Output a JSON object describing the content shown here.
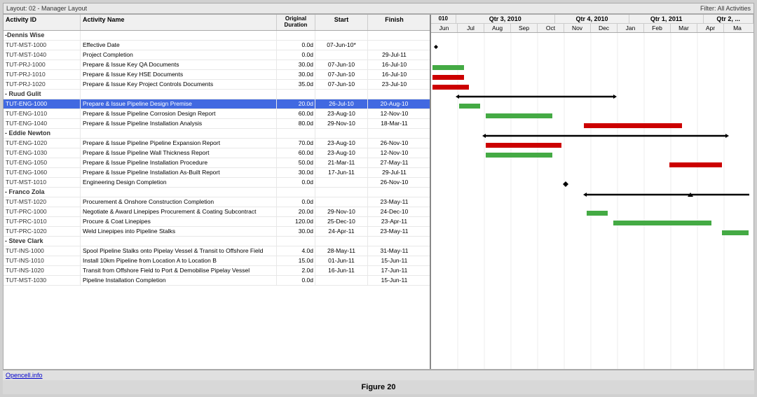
{
  "topbar": {
    "left": "Layout: 02 - Manager Layout",
    "right": "Filter: All Activities"
  },
  "columns": {
    "id": "Activity ID",
    "name": "Activity Name",
    "duration": "Original Duration",
    "start": "Start",
    "finish": "Finish"
  },
  "groups": [
    {
      "name": "Dennis Wise",
      "rows": [
        {
          "id": "TUT-MST-1000",
          "name": "Effective Date",
          "duration": "0.0d",
          "start": "07-Jun-10*",
          "finish": "",
          "bar": null
        },
        {
          "id": "TUT-MST-1040",
          "name": "Project Completion",
          "duration": "0.0d",
          "start": "",
          "finish": "29-Jul-11",
          "bar": null
        },
        {
          "id": "TUT-PRJ-1000",
          "name": "Prepare & Issue Key QA Documents",
          "duration": "30.0d",
          "start": "07-Jun-10",
          "finish": "16-Jul-10",
          "bar": "green-short"
        },
        {
          "id": "TUT-PRJ-1010",
          "name": "Prepare & Issue Key HSE Documents",
          "duration": "30.0d",
          "start": "07-Jun-10",
          "finish": "16-Jul-10",
          "bar": "red-short"
        },
        {
          "id": "TUT-PRJ-1020",
          "name": "Prepare & Issue Key Project Controls Documents",
          "duration": "35.0d",
          "start": "07-Jun-10",
          "finish": "23-Jul-10",
          "bar": "red-short2"
        }
      ]
    },
    {
      "name": "Ruud Gulit",
      "rows": [
        {
          "id": "TUT-ENG-1000",
          "name": "Prepare & Issue Pipeline Design Premise",
          "duration": "20.0d",
          "start": "26-Jul-10",
          "finish": "20-Aug-10",
          "bar": "green-mid",
          "selected": true
        },
        {
          "id": "TUT-ENG-1010",
          "name": "Prepare & Issue Pipeline Corrosion Design Report",
          "duration": "60.0d",
          "start": "23-Aug-10",
          "finish": "12-Nov-10",
          "bar": "green-long"
        },
        {
          "id": "TUT-ENG-1040",
          "name": "Prepare & Issue Pipeline Installation Analysis",
          "duration": "80.0d",
          "start": "29-Nov-10",
          "finish": "18-Mar-11",
          "bar": "red-long"
        }
      ]
    },
    {
      "name": "Eddie Newton",
      "rows": [
        {
          "id": "TUT-ENG-1020",
          "name": "Prepare & Issue Pipeline Pipeline Expansion Report",
          "duration": "70.0d",
          "start": "23-Aug-10",
          "finish": "26-Nov-10",
          "bar": "red-med"
        },
        {
          "id": "TUT-ENG-1030",
          "name": "Prepare & Issue Pipeline Wall Thickness Report",
          "duration": "60.0d",
          "start": "23-Aug-10",
          "finish": "12-Nov-10",
          "bar": "green-med"
        },
        {
          "id": "TUT-ENG-1050",
          "name": "Prepare & Issue Pipeline Installation Procedure",
          "duration": "50.0d",
          "start": "21-Mar-11",
          "finish": "27-May-11",
          "bar": "red-right"
        },
        {
          "id": "TUT-ENG-1060",
          "name": "Prepare & Issue Pipeline Installation As-Built Report",
          "duration": "30.0d",
          "start": "17-Jun-11",
          "finish": "29-Jul-11",
          "bar": null
        },
        {
          "id": "TUT-MST-1010",
          "name": "Engineering Design Completion",
          "duration": "0.0d",
          "start": "",
          "finish": "26-Nov-10",
          "bar": "diamond"
        }
      ]
    },
    {
      "name": "Franco Zola",
      "rows": [
        {
          "id": "TUT-MST-1020",
          "name": "Procurement & Onshore Construction Completion",
          "duration": "0.0d",
          "start": "",
          "finish": "23-May-11",
          "bar": "triangle"
        },
        {
          "id": "TUT-PRC-1000",
          "name": "Negotiate & Award Linepipes Procurement & Coating Subcontract",
          "duration": "20.0d",
          "start": "29-Nov-10",
          "finish": "24-Dec-10",
          "bar": "green-small"
        },
        {
          "id": "TUT-PRC-1010",
          "name": "Procure & Coat Linepipes",
          "duration": "120.0d",
          "start": "25-Dec-10",
          "finish": "23-Apr-11",
          "bar": "green-prc"
        },
        {
          "id": "TUT-PRC-1020",
          "name": "Weld Linepipes into Pipeline Stalks",
          "duration": "30.0d",
          "start": "24-Apr-11",
          "finish": "23-May-11",
          "bar": "green-far"
        }
      ]
    },
    {
      "name": "Steve Clark",
      "rows": [
        {
          "id": "TUT-INS-1000",
          "name": "Spool Pipeline Stalks onto Pipelay Vessel & Transit to Offshore Field",
          "duration": "4.0d",
          "start": "28-May-11",
          "finish": "31-May-11",
          "bar": null
        },
        {
          "id": "TUT-INS-1010",
          "name": "Install 10km Pipeline from Location A to Location B",
          "duration": "15.0d",
          "start": "01-Jun-11",
          "finish": "15-Jun-11",
          "bar": null
        },
        {
          "id": "TUT-INS-1020",
          "name": "Transit from Offshore Field to Port & Demobilise Pipelay Vessel",
          "duration": "2.0d",
          "start": "16-Jun-11",
          "finish": "17-Jun-11",
          "bar": null
        },
        {
          "id": "TUT-MST-1030",
          "name": "Pipeline Installation Completion",
          "duration": "0.0d",
          "start": "",
          "finish": "15-Jun-11",
          "bar": null
        }
      ]
    }
  ],
  "chart": {
    "quarters": [
      {
        "label": "Qtr 3, 2010",
        "months": [
          "Jun",
          "Jul",
          "Aug",
          "Sep"
        ]
      },
      {
        "label": "Qtr 4, 2010",
        "months": [
          "Oct",
          "Nov",
          "Dec"
        ]
      },
      {
        "label": "Qtr 1, 2011",
        "months": [
          "Jan",
          "Feb",
          "Mar"
        ]
      },
      {
        "label": "Qtr 2, ...",
        "months": [
          "Apr",
          "Ma"
        ]
      }
    ]
  },
  "bottom": {
    "link": "Opencell.info",
    "figure": "Figure 20"
  }
}
